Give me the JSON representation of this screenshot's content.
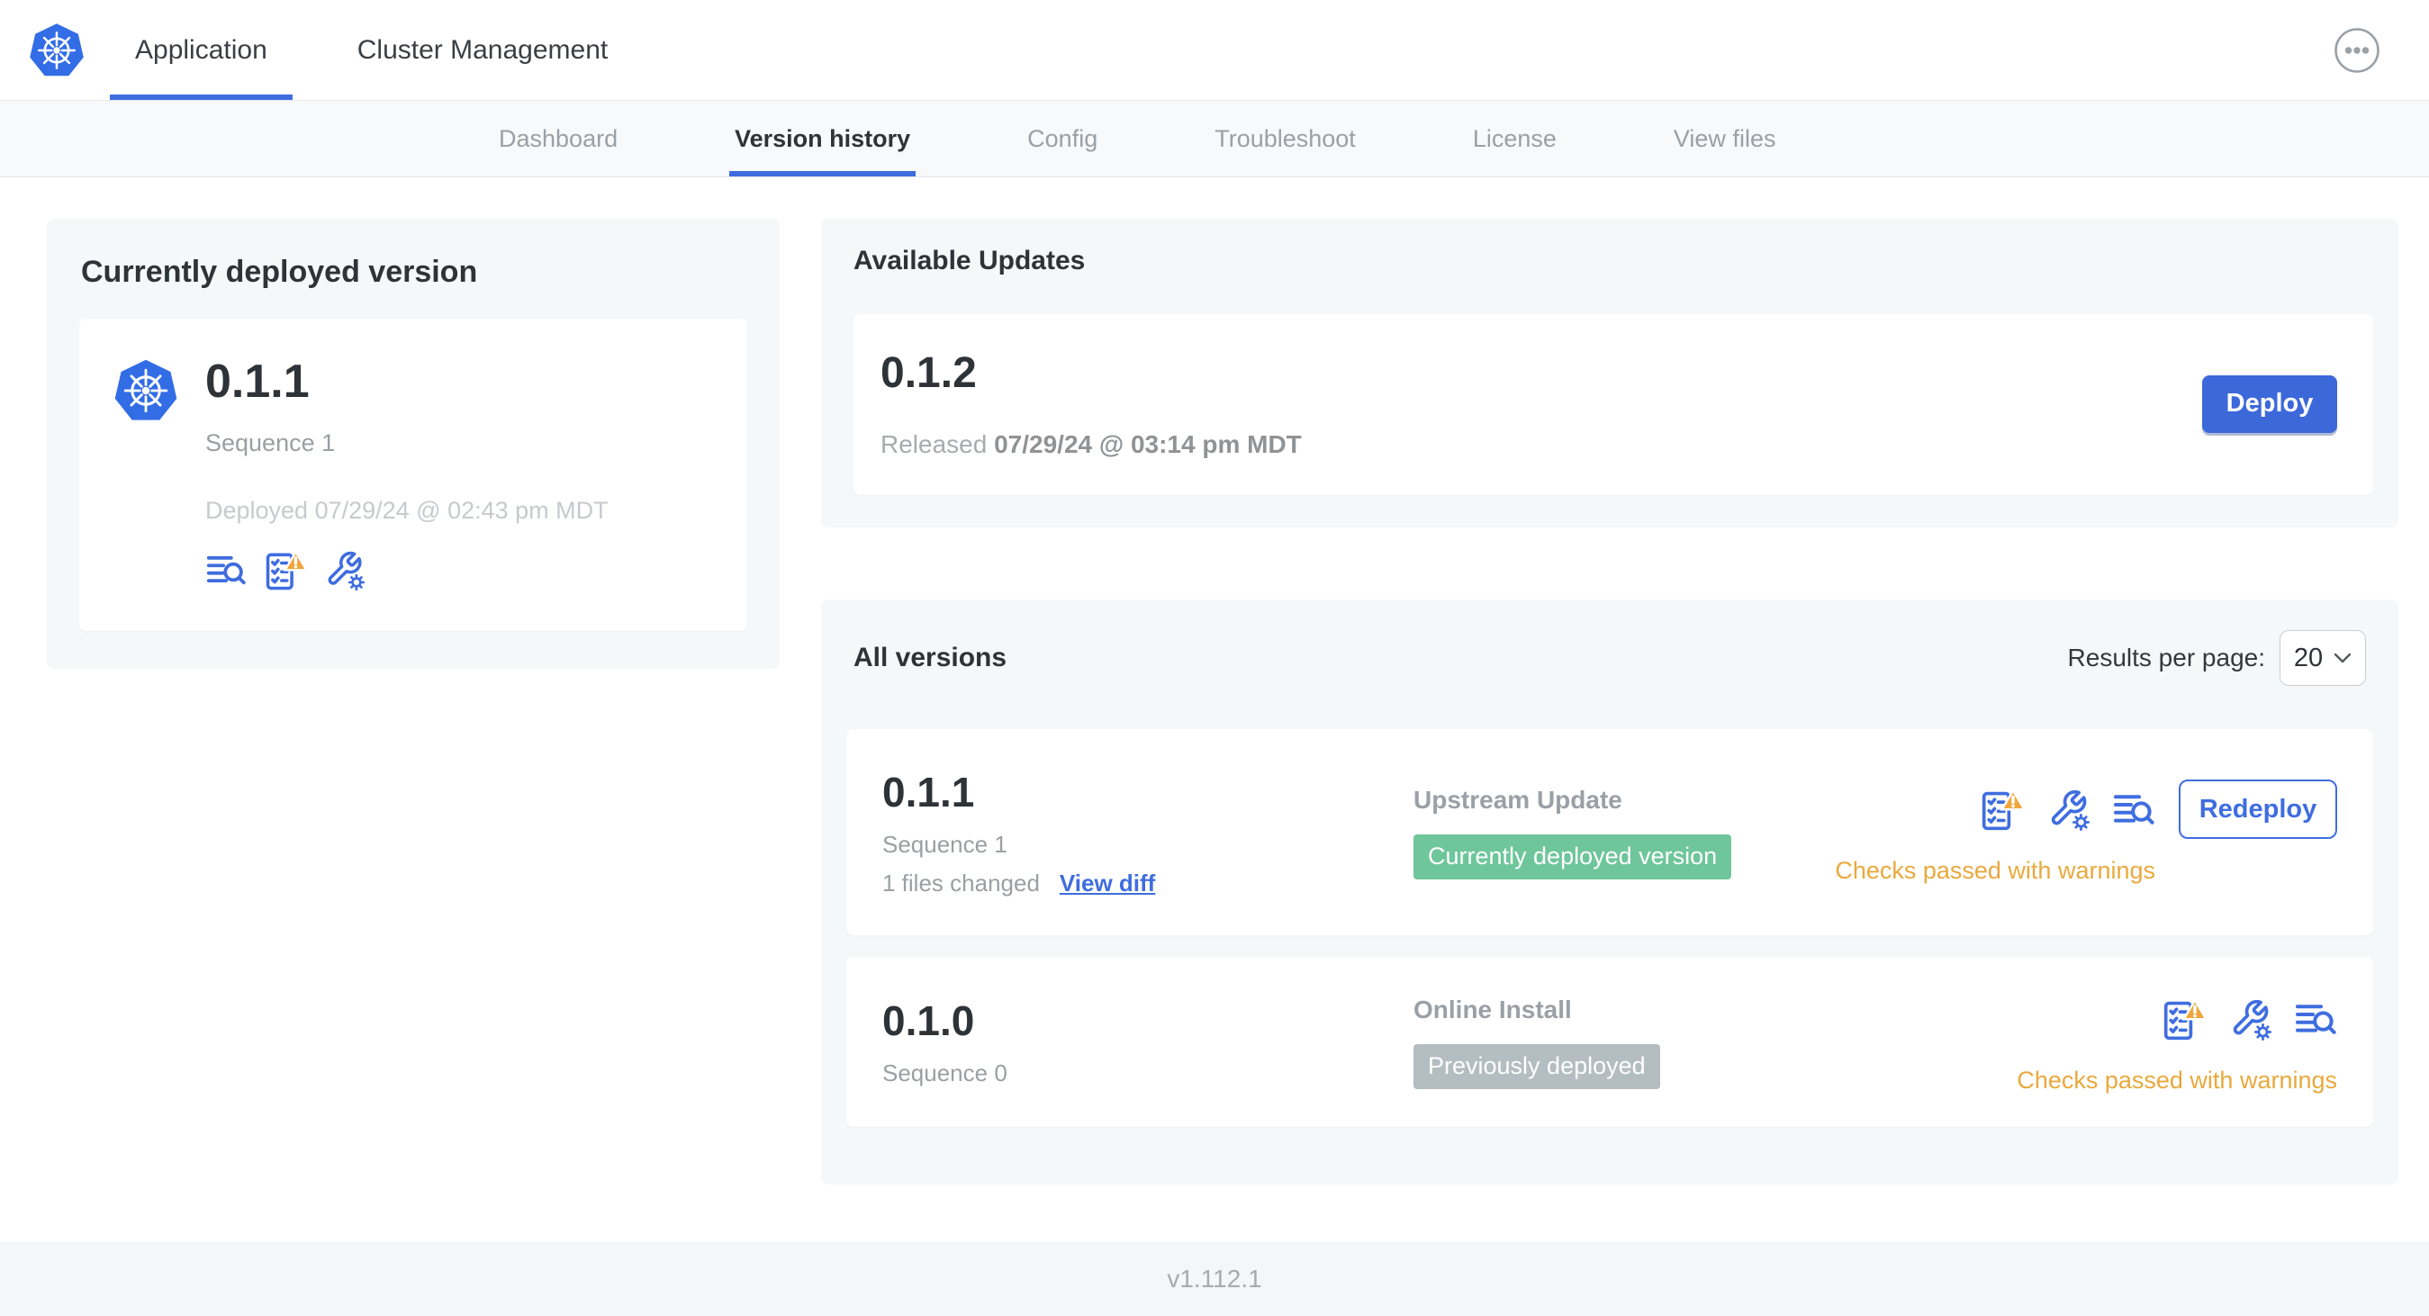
{
  "colors": {
    "primary_blue": "#3f6de0",
    "deploy_button_blue": "#3c68da",
    "kubernetes_blue": "#326de6",
    "badge_green": "#6ec69a",
    "badge_gray": "#b4bdc0",
    "warning_amber": "#e9a93d",
    "card_background": "#f5f8f9"
  },
  "icons": {
    "logo": "kubernetes-wheel",
    "more": "ellipsis-in-circle",
    "checks": "checklist-with-warning-triangle",
    "config": "wrench-with-gear",
    "logs": "lines-with-magnifier",
    "chevron": "chevron-down"
  },
  "topbar": {
    "tabs": [
      {
        "label": "Application"
      },
      {
        "label": "Cluster Management"
      }
    ]
  },
  "subnav": {
    "items": [
      {
        "label": "Dashboard"
      },
      {
        "label": "Version history"
      },
      {
        "label": "Config"
      },
      {
        "label": "Troubleshoot"
      },
      {
        "label": "License"
      },
      {
        "label": "View files"
      }
    ]
  },
  "currently_deployed": {
    "title": "Currently deployed version",
    "version": "0.1.1",
    "sequence": "Sequence 1",
    "deployed_at": "Deployed 07/29/24 @ 02:43 pm MDT"
  },
  "available_updates": {
    "title": "Available Updates",
    "version": "0.1.2",
    "released_prefix": "Released",
    "released_at": "07/29/24 @ 03:14 pm MDT",
    "deploy_label": "Deploy"
  },
  "all_versions": {
    "title": "All versions",
    "results_label": "Results per page:",
    "results_value": "20",
    "rows": [
      {
        "version": "0.1.1",
        "sequence": "Sequence 1",
        "files_changed": "1 files changed",
        "view_diff_label": "View diff",
        "source": "Upstream Update",
        "badge_label": "Currently deployed version",
        "status": "Checks passed with warnings",
        "action_label": "Redeploy"
      },
      {
        "version": "0.1.0",
        "sequence": "Sequence 0",
        "source": "Online Install",
        "badge_label": "Previously deployed",
        "status": "Checks passed with warnings"
      }
    ]
  },
  "footer": {
    "app_version": "v1.112.1"
  }
}
